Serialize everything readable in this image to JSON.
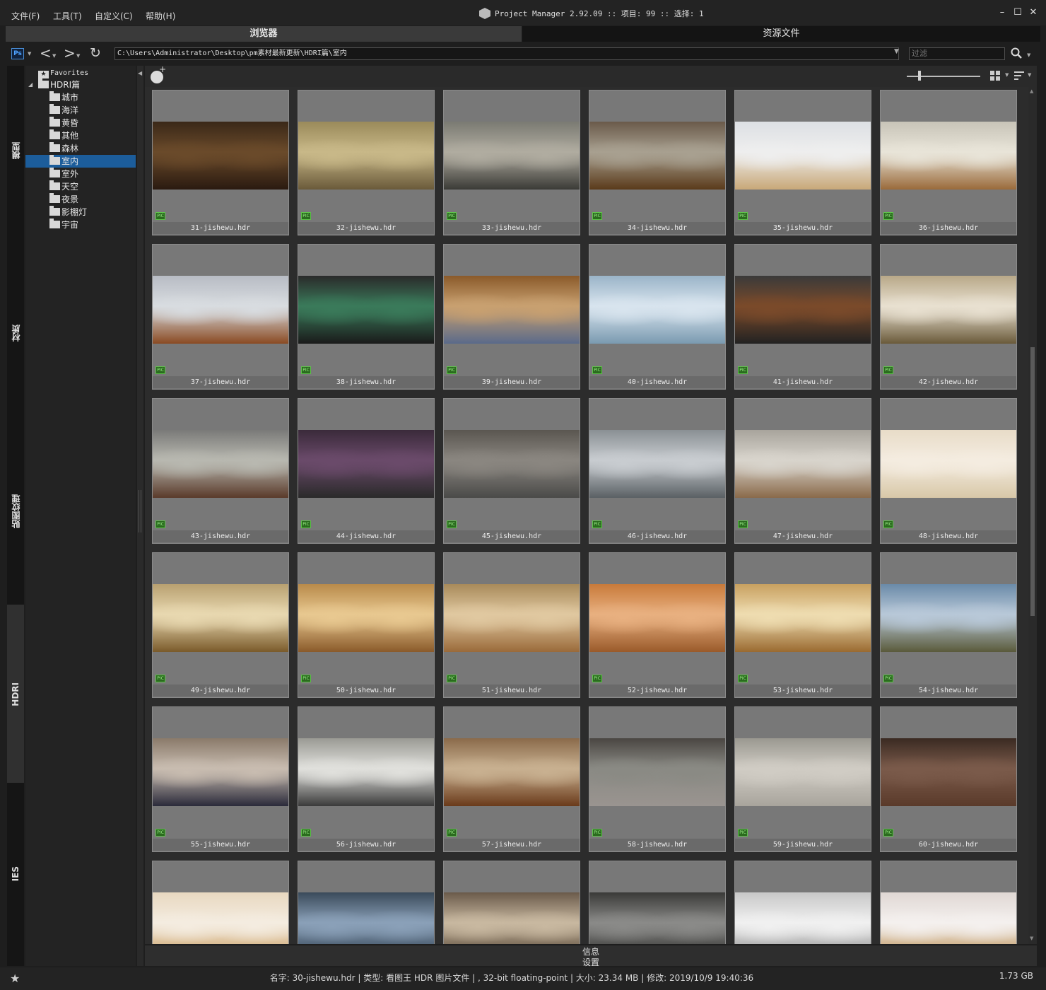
{
  "menu": [
    {
      "label": "文件(F)"
    },
    {
      "label": "工具(T)"
    },
    {
      "label": "自定义(C)"
    },
    {
      "label": "帮助(H)"
    }
  ],
  "app_title": "Project Manager 2.92.09  :: 项目: 99  :: 选择: 1",
  "window_buttons": {
    "minimize": "–",
    "maximize": "☐",
    "close": "✕"
  },
  "tabs": {
    "browser": "浏览器",
    "assets": "资源文件"
  },
  "toolbar": {
    "ps_label": "Ps",
    "back": "<",
    "forward": ">",
    "refresh": "↻",
    "path": "C:\\Users\\Administrator\\Desktop\\pm素材最新更新\\HDRI篇\\室内",
    "filter_placeholder": "过滤"
  },
  "categories": [
    {
      "label": "模型"
    },
    {
      "label": "材质"
    },
    {
      "label": "贴图纹理"
    },
    {
      "label": "HDRI"
    },
    {
      "label": "IES"
    }
  ],
  "tree": {
    "favorites": "Favorites",
    "root": "HDRI篇",
    "folders": [
      "城市",
      "海洋",
      "黄昏",
      "其他",
      "森林",
      "室内",
      "室外",
      "天空",
      "夜景",
      "影棚灯",
      "宇宙"
    ],
    "selected_index": 5
  },
  "grid": {
    "badge": "PIC",
    "items": [
      {
        "name": "31-jishewu.hdr",
        "colors": [
          "#3a2818",
          "#6a4a2a",
          "#2a1a10"
        ]
      },
      {
        "name": "32-jishewu.hdr",
        "colors": [
          "#9a8a5a",
          "#c8b888",
          "#6a5a3a"
        ]
      },
      {
        "name": "33-jishewu.hdr",
        "colors": [
          "#7a7a72",
          "#b0aca0",
          "#3a3a36"
        ]
      },
      {
        "name": "34-jishewu.hdr",
        "colors": [
          "#6a5a4a",
          "#a8a090",
          "#5a3a1a"
        ]
      },
      {
        "name": "35-jishewu.hdr",
        "colors": [
          "#dde0e4",
          "#eeeeee",
          "#c8a878"
        ]
      },
      {
        "name": "36-jishewu.hdr",
        "colors": [
          "#c8c4b8",
          "#e8e4d8",
          "#9a6a3a"
        ]
      },
      {
        "name": "37-jishewu.hdr",
        "colors": [
          "#b8bcc4",
          "#d8dce0",
          "#8a4a22"
        ]
      },
      {
        "name": "38-jishewu.hdr",
        "colors": [
          "#2a2a2a",
          "#3a7a5a",
          "#1a1a1a"
        ]
      },
      {
        "name": "39-jishewu.hdr",
        "colors": [
          "#8a5a2a",
          "#c8a070",
          "#5a6a8a"
        ]
      },
      {
        "name": "40-jishewu.hdr",
        "colors": [
          "#9ab4c8",
          "#d8e4ee",
          "#7a9ab0"
        ]
      },
      {
        "name": "41-jishewu.hdr",
        "colors": [
          "#3a3a3a",
          "#7a4a2a",
          "#222222"
        ]
      },
      {
        "name": "42-jishewu.hdr",
        "colors": [
          "#b8a888",
          "#e8e0d0",
          "#6a5a3a"
        ]
      },
      {
        "name": "43-jishewu.hdr",
        "colors": [
          "#7a7a78",
          "#b8b8b0",
          "#5a3a2a"
        ]
      },
      {
        "name": "44-jishewu.hdr",
        "colors": [
          "#3a2a3a",
          "#6a4a6a",
          "#2a2a2a"
        ]
      },
      {
        "name": "45-jishewu.hdr",
        "colors": [
          "#5a5650",
          "#8a8680",
          "#4a4a48"
        ]
      },
      {
        "name": "46-jishewu.hdr",
        "colors": [
          "#8a9094",
          "#c8ccd0",
          "#5a6064"
        ]
      },
      {
        "name": "47-jishewu.hdr",
        "colors": [
          "#a8a49c",
          "#d8d4cc",
          "#8a6a4a"
        ]
      },
      {
        "name": "48-jishewu.hdr",
        "colors": [
          "#e8dcc8",
          "#f4ece0",
          "#d8c8a8"
        ]
      },
      {
        "name": "49-jishewu.hdr",
        "colors": [
          "#b8a070",
          "#e8d8b0",
          "#7a5a2a"
        ]
      },
      {
        "name": "50-jishewu.hdr",
        "colors": [
          "#b88a4a",
          "#e8c890",
          "#8a5a2a"
        ]
      },
      {
        "name": "51-jishewu.hdr",
        "colors": [
          "#a88a5a",
          "#e0c8a0",
          "#9a6a3a"
        ]
      },
      {
        "name": "52-jishewu.hdr",
        "colors": [
          "#c87a3a",
          "#e8b080",
          "#9a5a2a"
        ]
      },
      {
        "name": "53-jishewu.hdr",
        "colors": [
          "#c8a060",
          "#eedcb0",
          "#9a6a30"
        ]
      },
      {
        "name": "54-jishewu.hdr",
        "colors": [
          "#6a8aa8",
          "#b8c8d8",
          "#5a5a3a"
        ]
      },
      {
        "name": "55-jishewu.hdr",
        "colors": [
          "#8a7a6a",
          "#c8bcb0",
          "#2a2a3a"
        ]
      },
      {
        "name": "56-jishewu.hdr",
        "colors": [
          "#9a9a94",
          "#e0e0dc",
          "#3a3a3a"
        ]
      },
      {
        "name": "57-jishewu.hdr",
        "colors": [
          "#8a6a4a",
          "#c8b090",
          "#6a3a1a"
        ]
      },
      {
        "name": "58-jishewu.hdr",
        "colors": [
          "#4a4642",
          "#8a8a84",
          "#9a9490"
        ]
      },
      {
        "name": "59-jishewu.hdr",
        "colors": [
          "#9a9890",
          "#d0ccc4",
          "#a8a49c"
        ]
      },
      {
        "name": "60-jishewu.hdr",
        "colors": [
          "#3a2a22",
          "#7a5a4a",
          "#5a3a2a"
        ]
      },
      {
        "name": "",
        "colors": [
          "#e8d8c0",
          "#f4ece0",
          "#c89a5a"
        ]
      },
      {
        "name": "",
        "colors": [
          "#3a4a5a",
          "#8aa0b8",
          "#2a3a4a"
        ]
      },
      {
        "name": "",
        "colors": [
          "#6a5a4a",
          "#c8b8a0",
          "#4a3a2a"
        ]
      },
      {
        "name": "",
        "colors": [
          "#3a3a38",
          "#8a8a88",
          "#2a2a28"
        ]
      },
      {
        "name": "",
        "colors": [
          "#c8c8c8",
          "#f0f0f0",
          "#8a8a8a"
        ]
      },
      {
        "name": "",
        "colors": [
          "#e0d8d4",
          "#f4f0ee",
          "#b88a4a"
        ]
      }
    ]
  },
  "info_tab": "信息",
  "settings_tab": "设置",
  "status": {
    "text": "名字: 30-jishewu.hdr | 类型: 看图王 HDR 图片文件 | , 32-bit floating-point | 大小: 23.34 MB | 修改: 2019/10/9 19:40:36",
    "disk_free": "1.73 GB",
    "star": "★"
  }
}
